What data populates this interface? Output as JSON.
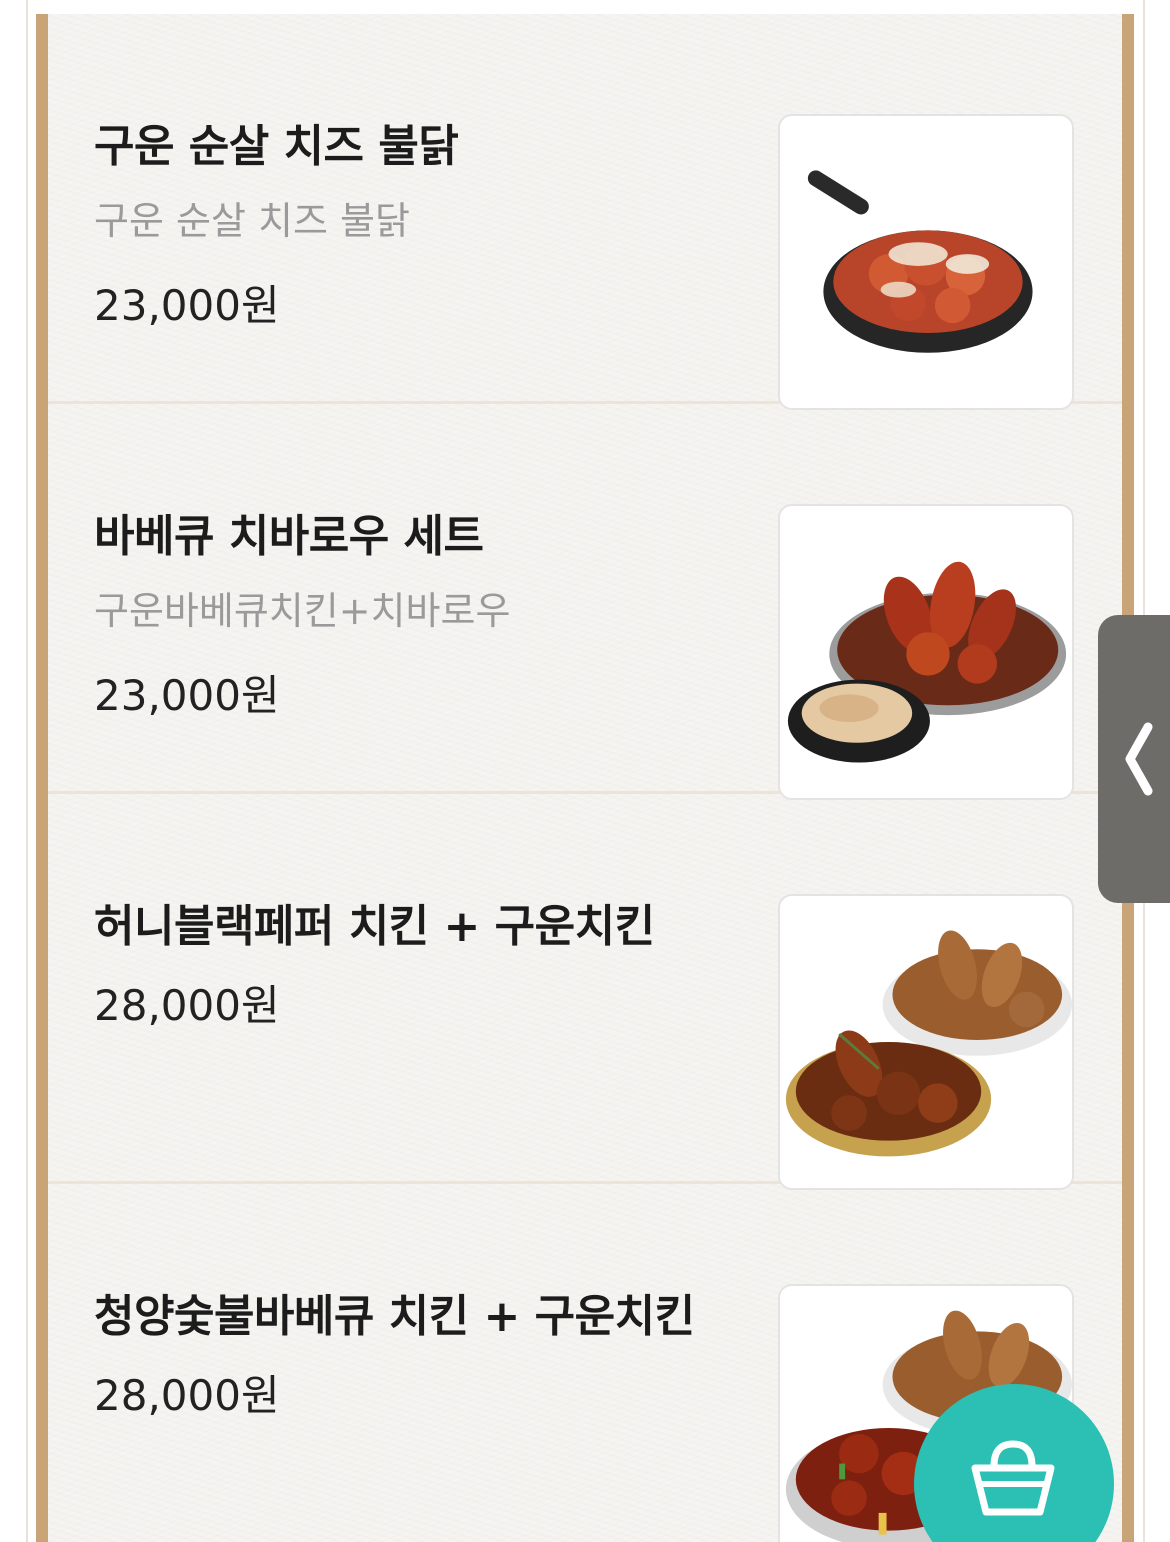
{
  "menu": {
    "items": [
      {
        "name": "구운 순살 치즈 불닭",
        "description": "구운 순살 치즈 불닭",
        "price": "23,000원",
        "image_icon": "cheese-buldak-skillet-photo"
      },
      {
        "name": "바베큐 치바로우 세트",
        "description": "구운바베큐치킨+치바로우",
        "price": "23,000원",
        "image_icon": "bbq-chicken-set-photo"
      },
      {
        "name": "허니블랙페퍼 치킨 + 구운치킨",
        "description": "",
        "price": "28,000원",
        "image_icon": "honey-black-pepper-chicken-photo"
      },
      {
        "name": "청양숯불바베큐 치킨 + 구운치킨",
        "description": "",
        "price": "28,000원",
        "image_icon": "cheongyang-bbq-chicken-photo"
      }
    ]
  },
  "side_tab": {
    "icon": "chevron-left-icon"
  },
  "cart": {
    "icon": "shopping-basket-icon",
    "color": "#2cbfb4"
  },
  "colors": {
    "frame_border": "#c9a477",
    "background": "#f5f4f1",
    "side_tab": "#6e6c69"
  }
}
